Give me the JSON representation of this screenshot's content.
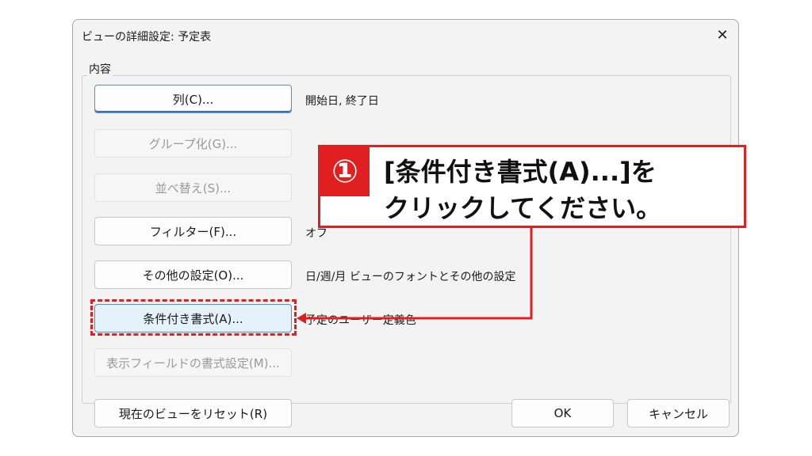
{
  "dialog": {
    "title": "ビューの詳細設定: 予定表",
    "close_glyph": "✕",
    "group_label": "内容",
    "rows": [
      {
        "button": "列(C)...",
        "description": "開始日, 終了日",
        "enabled": true
      },
      {
        "button": "グループ化(G)...",
        "description": "",
        "enabled": false
      },
      {
        "button": "並べ替え(S)...",
        "description": "",
        "enabled": false
      },
      {
        "button": "フィルター(F)...",
        "description": "オフ",
        "enabled": true
      },
      {
        "button": "その他の設定(O)...",
        "description": "日/週/月 ビューのフォントとその他の設定",
        "enabled": true
      },
      {
        "button": "条件付き書式(A)...",
        "description": "予定のユーザー定義色",
        "enabled": true
      },
      {
        "button": "表示フィールドの書式設定(M)...",
        "description": "",
        "enabled": false
      }
    ],
    "footer": {
      "reset": "現在のビューをリセット(R)",
      "ok": "OK",
      "cancel": "キャンセル"
    }
  },
  "callout": {
    "number": "①",
    "line1": "[条件付き書式(A)...]を",
    "line2": "クリックしてください。"
  },
  "colors": {
    "accent_red": "#e02020",
    "focus_blue": "#4a90d9"
  }
}
